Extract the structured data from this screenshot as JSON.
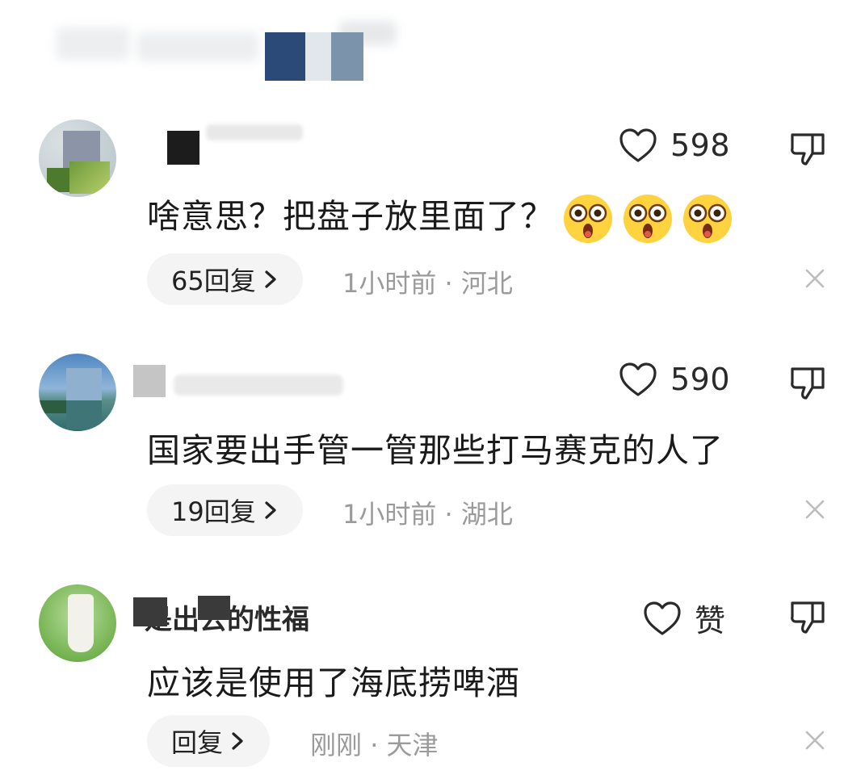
{
  "comments": [
    {
      "text": "啥意思？把盘子放里面了？",
      "emoji_icons": [
        "astonished-face-icon",
        "astonished-face-icon",
        "astonished-face-icon"
      ],
      "likes": "598",
      "reply_label": "65回复",
      "time": "1小时前",
      "separator": "·",
      "location": "河北"
    },
    {
      "text": "国家要出手管一管那些打马赛克的人了",
      "likes": "590",
      "reply_label": "19回复",
      "time": "1小时前",
      "separator": "·",
      "location": "湖北"
    },
    {
      "username_visible": "是出去的性福",
      "text": "应该是使用了海底捞啤酒",
      "likes": "赞",
      "reply_label": "回复",
      "time": "刚刚",
      "separator": "·",
      "location": "天津"
    }
  ],
  "colors": {
    "pill_bg": "#f4f4f5",
    "meta_text": "#9a9a9a",
    "icon_stroke": "#2a2a2a"
  }
}
